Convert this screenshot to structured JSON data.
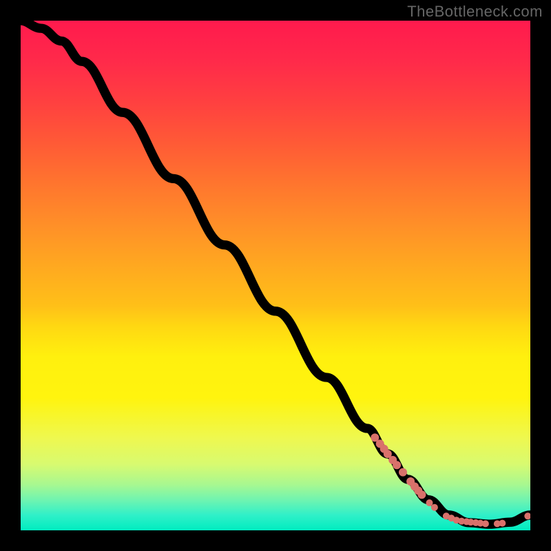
{
  "watermark": "TheBottleneck.com",
  "chart_data": {
    "type": "line",
    "title": "",
    "xlabel": "",
    "ylabel": "",
    "xlim": [
      0,
      100
    ],
    "ylim": [
      0,
      100
    ],
    "curve": [
      {
        "x": 0,
        "y": 100
      },
      {
        "x": 4,
        "y": 98.5
      },
      {
        "x": 8,
        "y": 96
      },
      {
        "x": 12,
        "y": 92
      },
      {
        "x": 20,
        "y": 82
      },
      {
        "x": 30,
        "y": 69
      },
      {
        "x": 40,
        "y": 56
      },
      {
        "x": 50,
        "y": 43
      },
      {
        "x": 60,
        "y": 30
      },
      {
        "x": 68,
        "y": 20
      },
      {
        "x": 72,
        "y": 15
      },
      {
        "x": 76,
        "y": 10
      },
      {
        "x": 80,
        "y": 6
      },
      {
        "x": 84,
        "y": 3
      },
      {
        "x": 88,
        "y": 1.5
      },
      {
        "x": 92,
        "y": 1.2
      },
      {
        "x": 96,
        "y": 1.6
      },
      {
        "x": 100,
        "y": 3
      }
    ],
    "points": [
      {
        "x": 69.5,
        "y": 18.2,
        "r": 6
      },
      {
        "x": 70.5,
        "y": 17.0,
        "r": 6
      },
      {
        "x": 71.3,
        "y": 16.0,
        "r": 6
      },
      {
        "x": 72.0,
        "y": 15.0,
        "r": 6
      },
      {
        "x": 73.0,
        "y": 13.8,
        "r": 6
      },
      {
        "x": 73.8,
        "y": 12.8,
        "r": 6
      },
      {
        "x": 75.0,
        "y": 11.4,
        "r": 6
      },
      {
        "x": 76.5,
        "y": 9.6,
        "r": 6
      },
      {
        "x": 77.3,
        "y": 8.6,
        "r": 6
      },
      {
        "x": 78.0,
        "y": 7.8,
        "r": 6
      },
      {
        "x": 78.7,
        "y": 7.0,
        "r": 6
      },
      {
        "x": 80.2,
        "y": 5.4,
        "r": 5
      },
      {
        "x": 81.2,
        "y": 4.5,
        "r": 5
      },
      {
        "x": 83.5,
        "y": 2.8,
        "r": 5
      },
      {
        "x": 84.5,
        "y": 2.4,
        "r": 5
      },
      {
        "x": 85.5,
        "y": 2.0,
        "r": 5
      },
      {
        "x": 86.5,
        "y": 1.8,
        "r": 5
      },
      {
        "x": 87.5,
        "y": 1.7,
        "r": 5
      },
      {
        "x": 88.3,
        "y": 1.6,
        "r": 5
      },
      {
        "x": 89.3,
        "y": 1.5,
        "r": 5
      },
      {
        "x": 90.2,
        "y": 1.4,
        "r": 5
      },
      {
        "x": 91.2,
        "y": 1.3,
        "r": 5
      },
      {
        "x": 93.5,
        "y": 1.3,
        "r": 5
      },
      {
        "x": 94.5,
        "y": 1.4,
        "r": 5
      },
      {
        "x": 99.5,
        "y": 2.8,
        "r": 5
      }
    ],
    "colors": {
      "curve": "#000000",
      "dot": "#d9716b",
      "gradient_top": "#ff1a4d",
      "gradient_mid": "#fff40e",
      "gradient_bottom": "#00ecc0"
    }
  }
}
